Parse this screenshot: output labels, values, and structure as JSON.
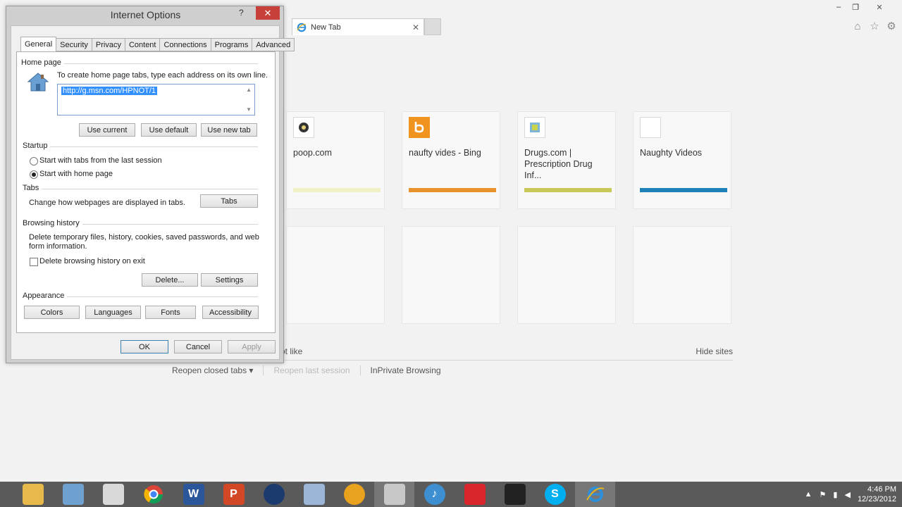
{
  "browser": {
    "tab_title": "New Tab",
    "tab_close": "✕",
    "window_controls": {
      "minimize": "–",
      "restore": "❐",
      "close": "✕"
    },
    "nav_icons": [
      "home-icon",
      "favorites-star-icon",
      "tools-gear-icon"
    ],
    "tiles": [
      {
        "title": "poop.com",
        "bar_color": "#f1f1c8"
      },
      {
        "title": "naufty vides - Bing",
        "bar_color": "#e8922e"
      },
      {
        "title": "Drugs.com | Prescription Drug Inf...",
        "bar_color": "#c9c95a"
      },
      {
        "title": "Naughty Videos",
        "bar_color": "#1e82b8"
      }
    ],
    "partial_left_text": "ot like",
    "hide_sites": "Hide sites",
    "reopen_closed_tabs": "Reopen closed tabs ▾",
    "reopen_last_session": "Reopen last session",
    "inprivate": "InPrivate Browsing"
  },
  "dialog": {
    "title": "Internet Options",
    "help": "?",
    "close": "✕",
    "tabs": [
      "General",
      "Security",
      "Privacy",
      "Content",
      "Connections",
      "Programs",
      "Advanced"
    ],
    "home_page": {
      "label": "Home page",
      "instruction": "To create home page tabs, type each address on its own line.",
      "url": "http://g.msn.com/HPNOT/1",
      "use_current": "Use current",
      "use_default": "Use default",
      "use_new_tab": "Use new tab"
    },
    "startup": {
      "label": "Startup",
      "option_last_session": "Start with tabs from the last session",
      "option_home_page": "Start with home page",
      "selected": "Start with home page"
    },
    "tabs_section": {
      "label": "Tabs",
      "description": "Change how webpages are displayed in tabs.",
      "button": "Tabs"
    },
    "browsing_history": {
      "label": "Browsing history",
      "description_line1": "Delete temporary files, history, cookies, saved passwords, and web",
      "description_line2": "form information.",
      "checkbox_label": "Delete browsing history on exit",
      "delete": "Delete...",
      "settings": "Settings"
    },
    "appearance": {
      "label": "Appearance",
      "colors": "Colors",
      "languages": "Languages",
      "fonts": "Fonts",
      "accessibility": "Accessibility"
    },
    "ok": "OK",
    "cancel": "Cancel",
    "apply": "Apply"
  },
  "taskbar": {
    "apps": [
      "file-explorer-icon",
      "control-panel-icon",
      "paint-icon",
      "chrome-icon",
      "word-icon",
      "powerpoint-icon",
      "media-center-icon",
      "notepad-icon",
      "music-icon",
      "windows-live-movie-icon",
      "itunes-icon",
      "sketchup-icon",
      "app-icon",
      "skype-icon",
      "internet-explorer-icon"
    ],
    "time": "4:46 PM",
    "date": "12/23/2012"
  }
}
